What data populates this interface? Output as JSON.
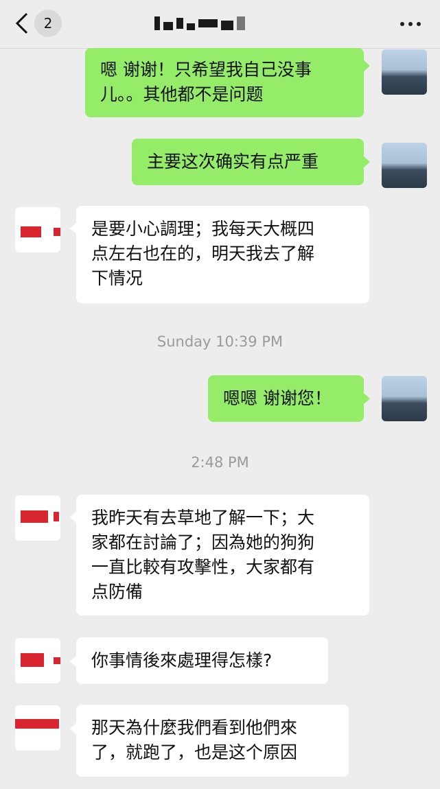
{
  "header": {
    "back_label": "Back",
    "unread_count": "2",
    "more_label": "More"
  },
  "colors": {
    "sent_bubble": "#95ec69",
    "received_bubble": "#ffffff",
    "background": "#ededed",
    "timestamp_text": "#9a9a9a"
  },
  "messages": [
    {
      "from": "me",
      "text": "嗯 谢谢！只希望我自己没事\n儿。。其他都不是问题"
    },
    {
      "from": "me",
      "text": "主要这次确实有点严重"
    },
    {
      "from": "them",
      "text": "是要小心調理；我每天大概四\n点左右也在的，明天我去了解\n下情况"
    },
    {
      "from": "me",
      "text": "嗯嗯 谢谢您！"
    },
    {
      "from": "them",
      "text": "我昨天有去草地了解一下；大\n家都在討論了；因為她的狗狗\n一直比較有攻擊性，大家都有\n点防備"
    },
    {
      "from": "them",
      "text": "你事情後來處理得怎樣?"
    },
    {
      "from": "them",
      "text": "那天為什麼我們看到他們來\n了，就跑了，也是这个原因"
    }
  ],
  "timestamps": [
    "Sunday 10:39 PM",
    "2:48 PM"
  ]
}
